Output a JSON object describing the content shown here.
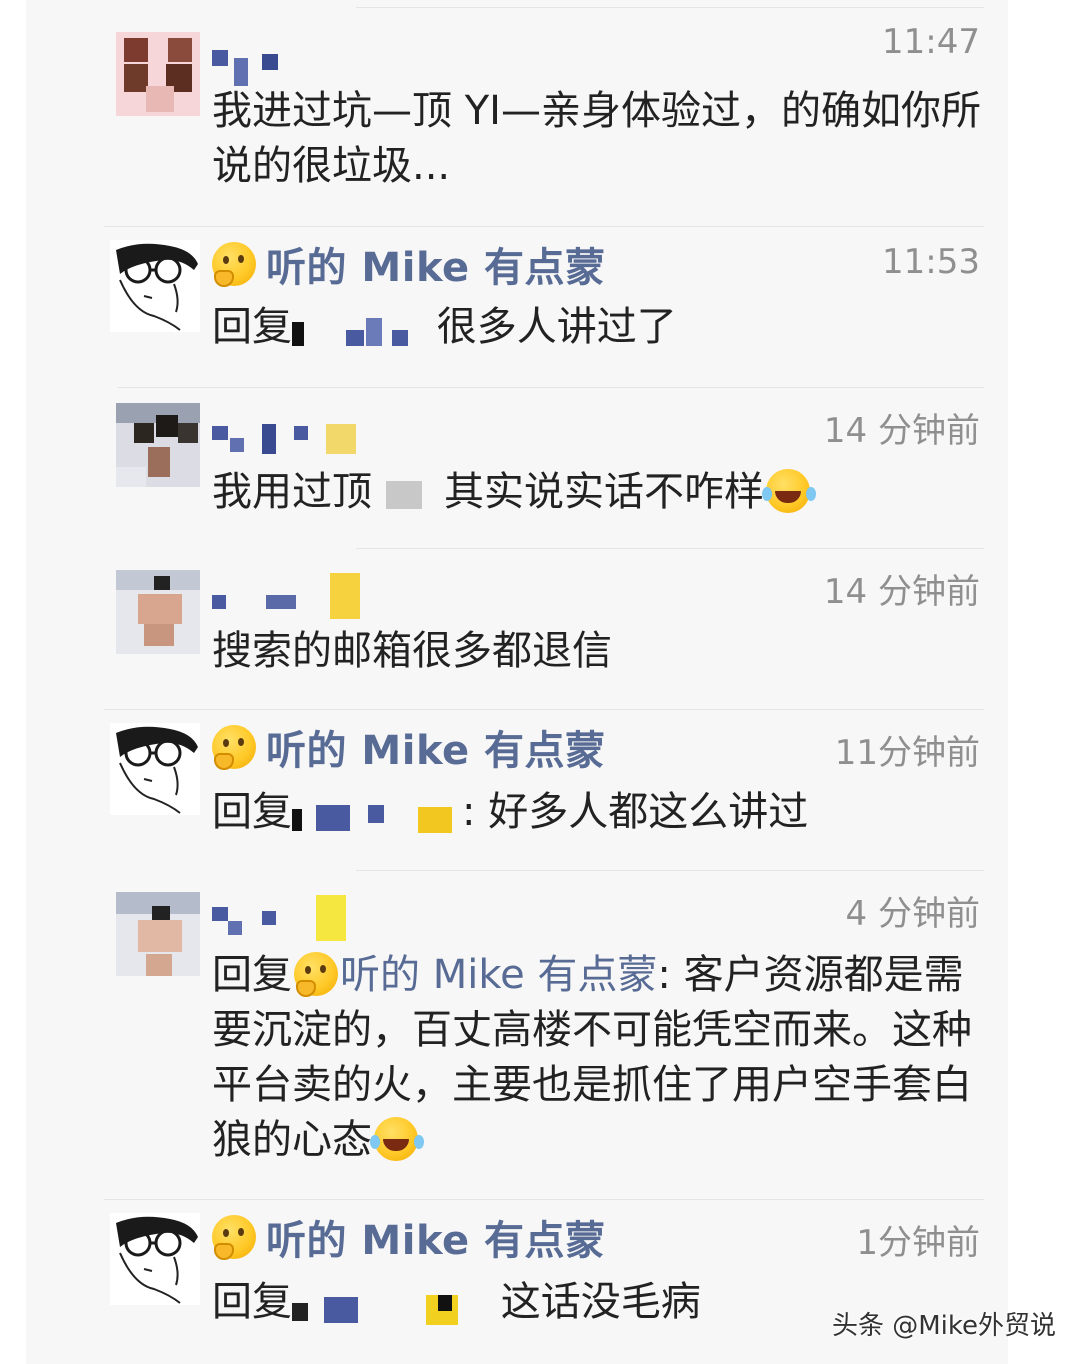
{
  "comments": [
    {
      "author": "",
      "time": "11:47",
      "text": "我进过坑—顶 YI—亲身体验过，的确如你所说的很垃圾..."
    },
    {
      "author": "听的 Mike 有点蒙",
      "time": "11:53",
      "reply_prefix": "回复",
      "text": "很多人讲过了"
    },
    {
      "author": "",
      "time": "14 分钟前",
      "text_a": "我用过顶",
      "text_b": "其实说实话不咋样"
    },
    {
      "author": "",
      "time": "14 分钟前",
      "text": "搜索的邮箱很多都退信"
    },
    {
      "author": "听的 Mike 有点蒙",
      "time": "11分钟前",
      "reply_prefix": "回复",
      "text": ": 好多人都这么讲过"
    },
    {
      "author": "",
      "time": "4 分钟前",
      "reply_prefix": "回复",
      "reply_to": "听的 Mike 有点蒙",
      "text": ": 客户资源都是需要沉淀的，百丈高楼不可能凭空而来。这种平台卖的火，主要也是抓住了用户空手套白狼的心态"
    },
    {
      "author": "听的 Mike 有点蒙",
      "time": "1分钟前",
      "reply_prefix": "回复",
      "text": "这话没毛病"
    }
  ],
  "icons": {
    "thinking": "thinking-face-icon",
    "laughing": "tears-of-joy-icon"
  },
  "colors": {
    "name": "#576b95",
    "time": "#8f8f8f",
    "text": "#222222",
    "panel": "#f7f7f7"
  },
  "watermark": "头条 @Mike外贸说"
}
